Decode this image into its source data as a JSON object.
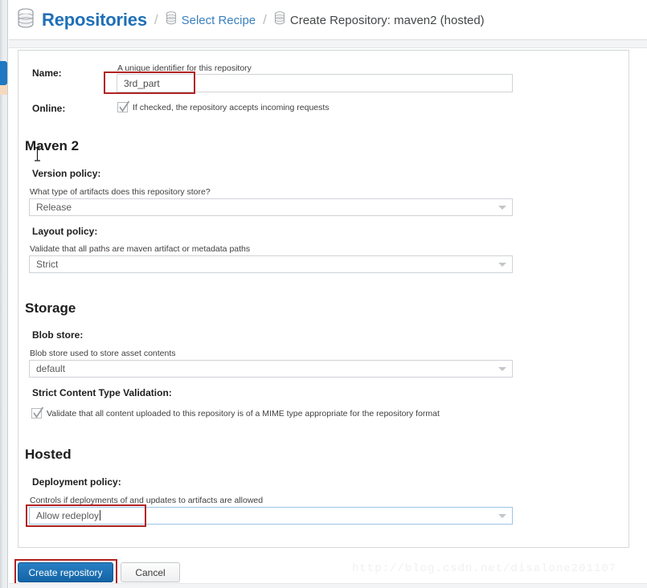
{
  "header": {
    "title": "Repositories",
    "title_icon": "database-icon",
    "separator": "/",
    "breadcrumbs": [
      {
        "icon": "database-icon",
        "label": "Select Recipe",
        "current": false
      },
      {
        "icon": "database-icon",
        "label": "Create Repository: maven2 (hosted)",
        "current": true
      }
    ]
  },
  "form": {
    "name_field": {
      "label": "Name:",
      "help": "A unique identifier for this repository",
      "value": "3rd_part",
      "placeholder": ""
    },
    "online_field": {
      "label": "Online:",
      "checkbox_label": "If checked, the repository accepts incoming requests",
      "checked": true
    }
  },
  "sections": [
    {
      "heading": "Maven 2",
      "fields": [
        {
          "label": "Version policy:",
          "help": "What type of artifacts does this repository store?",
          "control": "select",
          "value": "Release",
          "focused": false
        },
        {
          "label": "Layout policy:",
          "help": "Validate that all paths are maven artifact or metadata paths",
          "control": "select",
          "value": "Strict",
          "focused": false
        }
      ]
    },
    {
      "heading": "Storage",
      "fields": [
        {
          "label": "Blob store:",
          "help": "Blob store used to store asset contents",
          "control": "select",
          "value": "default",
          "focused": false
        },
        {
          "label": "Strict Content Type Validation:",
          "control": "checkbox",
          "checkbox_label": "Validate that all content uploaded to this repository is of a MIME type appropriate for the repository format",
          "checked": true
        }
      ]
    },
    {
      "heading": "Hosted",
      "fields": [
        {
          "label": "Deployment policy:",
          "help": "Controls if deployments of and updates to artifacts are allowed",
          "control": "select",
          "value": "Allow redeploy",
          "focused": true
        }
      ]
    }
  ],
  "actions": {
    "create_label": "Create repository",
    "cancel_label": "Cancel"
  },
  "annotations": {
    "count": 3,
    "color": "#b22222",
    "targets": [
      "name-input-value",
      "deployment-policy-value",
      "create-repository-button"
    ]
  },
  "watermark": "http://blog.csdn.net/disalone201107",
  "colors": {
    "brand_blue": "#1f6fb8",
    "link_blue": "#3a7fbe",
    "button_blue": "#1264a5",
    "annotation_red": "#b22222",
    "focus_border": "#9dc4e4"
  }
}
